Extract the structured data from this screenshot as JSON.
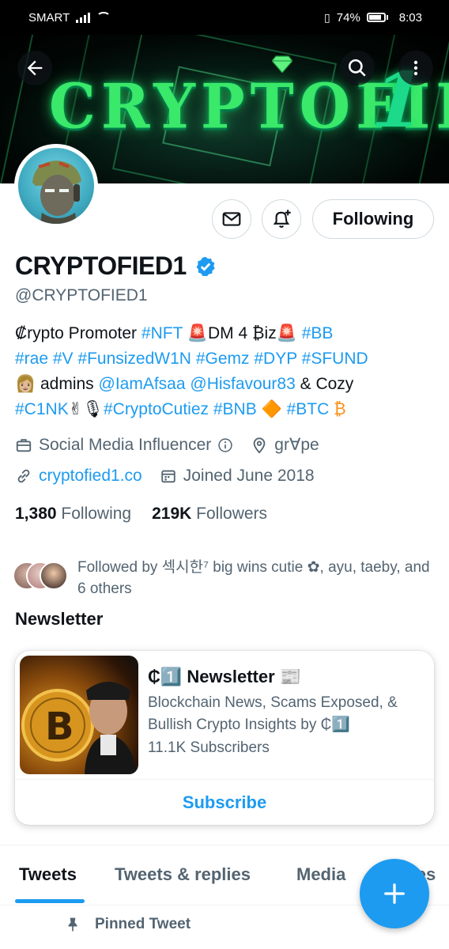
{
  "status_bar": {
    "carrier": "SMART",
    "battery": "74%",
    "time": "8:03"
  },
  "banner": {
    "text": "CRYPTOFIED",
    "numeral": "1"
  },
  "profile": {
    "name": "CRYPTOFIED1",
    "handle": "@CRYPTOFIED1",
    "follow_button": "Following",
    "bio": {
      "line1": [
        "₡rypto Promoter ",
        "#NFT",
        " 🚨DM 4 ₿iz🚨 ",
        "#BB"
      ],
      "line2": [
        "#rae",
        " ",
        "#V",
        " ",
        "#FunsizedW1N",
        " ",
        "#Gemz",
        " ",
        "#DYP",
        " ",
        "#SFUND"
      ],
      "line3": [
        "👩🏼 admins ",
        "@IamAfsaa",
        " ",
        "@Hisfavour83",
        " & Cozy"
      ],
      "line4": [
        "#C1NK",
        "✌🎙",
        "#CryptoCutiez",
        " ",
        "#BNB",
        " 🔶 ",
        "#BTC",
        " ₿"
      ]
    },
    "category": "Social Media Influencer",
    "location": "gr∀pe",
    "website": "cryptofied1.co",
    "joined": "Joined June 2018",
    "following_count": "1,380",
    "following_label": "Following",
    "followers_count": "219K",
    "followers_label": "Followers",
    "followed_by": "Followed by 섹시한⁷ big wins cutie ✿, ayu, taeby, and 6 others"
  },
  "newsletter": {
    "section_title": "Newsletter",
    "title": "₵1️⃣  Newsletter 📰",
    "description": "Blockchain News, Scams Exposed, & Bullish Crypto Insights by ₵1️⃣",
    "subscribers": "11.1K Subscribers",
    "subscribe_label": "Subscribe"
  },
  "tabs": [
    {
      "label": "Tweets",
      "active": true
    },
    {
      "label": "Tweets & replies",
      "active": false
    },
    {
      "label": "Media",
      "active": false
    },
    {
      "label": "Likes",
      "active": false
    }
  ],
  "pinned": "Pinned Tweet",
  "colors": {
    "accent": "#1d9bf0",
    "text": "#0f1419",
    "secondary_text": "#536471",
    "banner_green": "#3ae86a"
  },
  "icons": [
    "back-arrow-icon",
    "search-icon",
    "more-vertical-icon",
    "mail-icon",
    "bell-plus-icon",
    "verified-badge-icon",
    "briefcase-icon",
    "info-icon",
    "location-pin-icon",
    "link-icon",
    "calendar-icon",
    "pin-icon",
    "plus-icon"
  ]
}
